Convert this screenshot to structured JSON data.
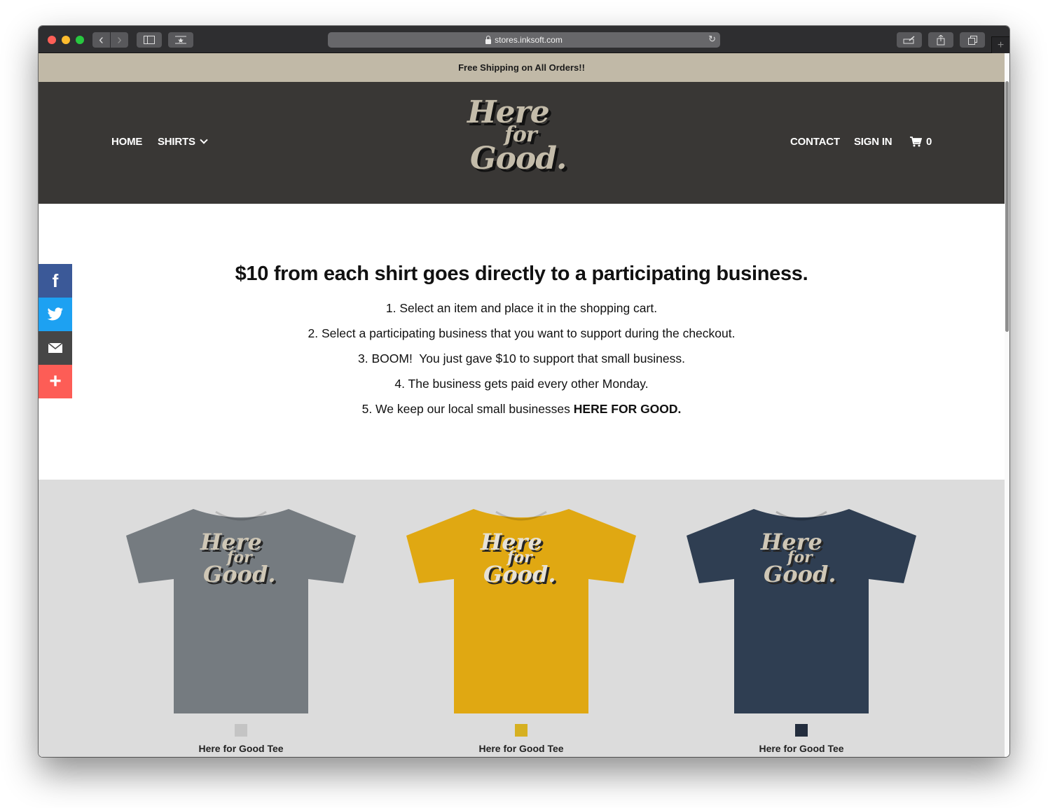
{
  "browser": {
    "url": "stores.inksoft.com",
    "icons": {
      "back": "chevron-left-icon",
      "forward": "chevron-right-icon",
      "sidebar": "sidebar-icon",
      "top_sites": "star-icon",
      "lock": "lock-icon",
      "reload": "reload-icon",
      "markup": "markup-icon",
      "share": "share-icon",
      "tabs": "tabs-overview-icon",
      "new_tab": "plus-icon"
    },
    "back_glyph": "‹",
    "forward_glyph": "›",
    "reload_glyph": "↻",
    "newtab_glyph": "+"
  },
  "promo": {
    "text": "Free Shipping on All Orders!!"
  },
  "header": {
    "nav_left": [
      {
        "label": "HOME"
      },
      {
        "label": "SHIRTS"
      }
    ],
    "nav_right": [
      {
        "label": "CONTACT"
      },
      {
        "label": "SIGN IN"
      }
    ],
    "cart_count": "0",
    "logo": {
      "line1": "Here",
      "line2": "for",
      "line3": "Good."
    }
  },
  "info": {
    "title": "$10 from each shirt goes directly to a participating business.",
    "steps": [
      "1. Select an item and place it in the shopping cart.",
      "2. Select a participating business that you want to support during the checkout.",
      "3. BOOM!  You just gave $10 to support that small business.",
      "4. The business gets paid every other Monday."
    ],
    "step5_prefix": "5. We keep our local small businesses ",
    "step5_bold": "HERE FOR GOOD."
  },
  "share": {
    "facebook_glyph": "f",
    "more_glyph": "+"
  },
  "products": [
    {
      "name": "Here for Good Tee",
      "shirt_color": "#757b80",
      "swatch_color": "#c4c4c4"
    },
    {
      "name": "Here for Good Tee",
      "shirt_color": "#e0a812",
      "swatch_color": "#d6b021"
    },
    {
      "name": "Here for Good Tee",
      "shirt_color": "#2f3e52",
      "swatch_color": "#232d3d"
    }
  ],
  "colors": {
    "promo_bg": "#c1b9a7",
    "header_bg": "#393735",
    "products_bg": "#dcdcdc",
    "facebook": "#3b5998",
    "twitter": "#1da1f2",
    "email": "#464646",
    "more": "#fd5d56"
  }
}
